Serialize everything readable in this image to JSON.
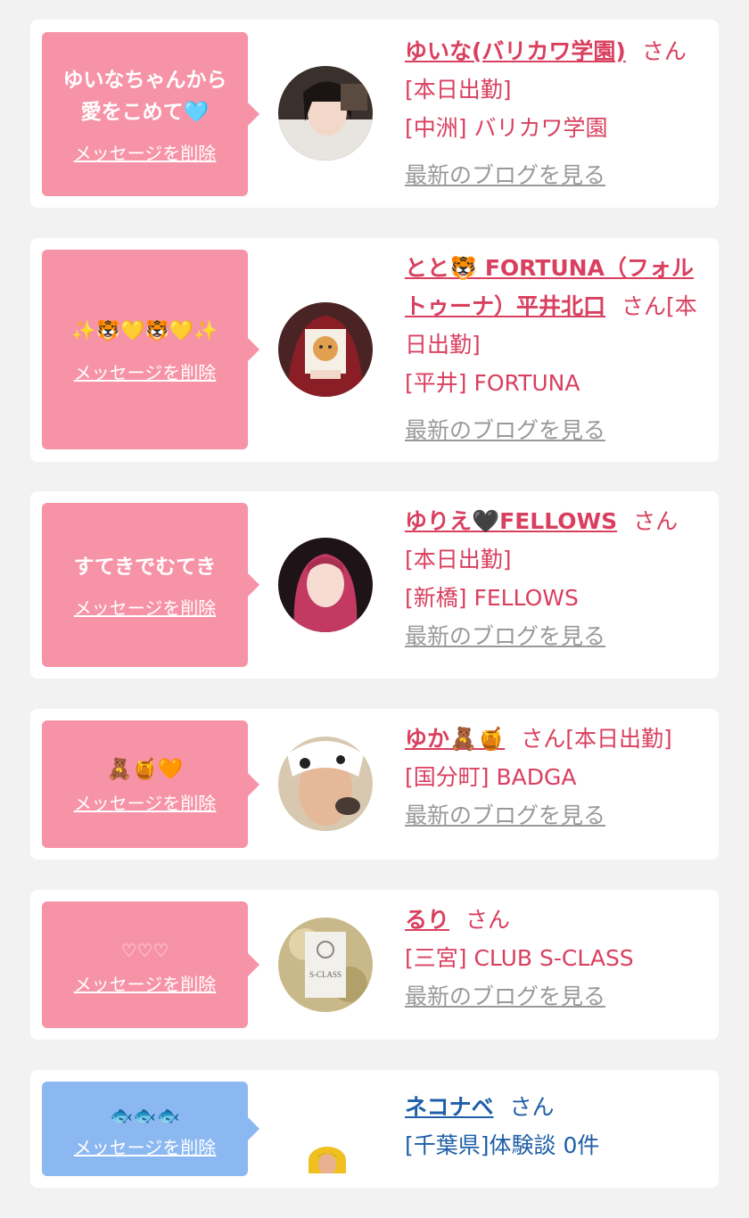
{
  "delete_label": "メッセージを削除",
  "blog_label": "最新のブログを見る",
  "san_label": "さん",
  "entries": [
    {
      "message": "ゆいなちゃんから愛をこめて🩵",
      "name": "ゆいな(バリカワ学園)",
      "status": "[本日出勤]",
      "shop": "[中洲] バリカワ学園",
      "avatar_icon": "avatar-photo-1"
    },
    {
      "message": "✨🐯💛🐯💛✨",
      "name": "とと🐯 FORTUNA（フォルトゥーナ）平井北口",
      "status": "[本日出勤]",
      "shop": "[平井] FORTUNA",
      "avatar_icon": "avatar-photo-2"
    },
    {
      "message": "すてきでむてき",
      "name": "ゆりえ🖤FELLOWS",
      "status": "[本日出勤]",
      "shop": "[新橋] FELLOWS",
      "avatar_icon": "avatar-photo-3"
    },
    {
      "message": "🧸🍯🧡",
      "name": "ゆか🧸🍯",
      "status": "[本日出勤]",
      "shop": "[国分町] BADGA",
      "avatar_icon": "avatar-photo-4"
    },
    {
      "message": "♡♡♡",
      "name": "るり",
      "status": "",
      "shop": "[三宮] CLUB S-CLASS",
      "avatar_icon": "avatar-logo-sclass",
      "avatar_text": "S-CLASS"
    },
    {
      "message": "🐟🐟🐟",
      "name": "ネコナベ",
      "status": "",
      "shop": "[千葉県]体験談 0件",
      "avatar_icon": "avatar-small"
    }
  ],
  "colors": {
    "pink_bubble": "#f793a6",
    "blue_bubble": "#8cb8f2",
    "pink_text": "#d9405f",
    "blue_text": "#1f5fa8"
  }
}
